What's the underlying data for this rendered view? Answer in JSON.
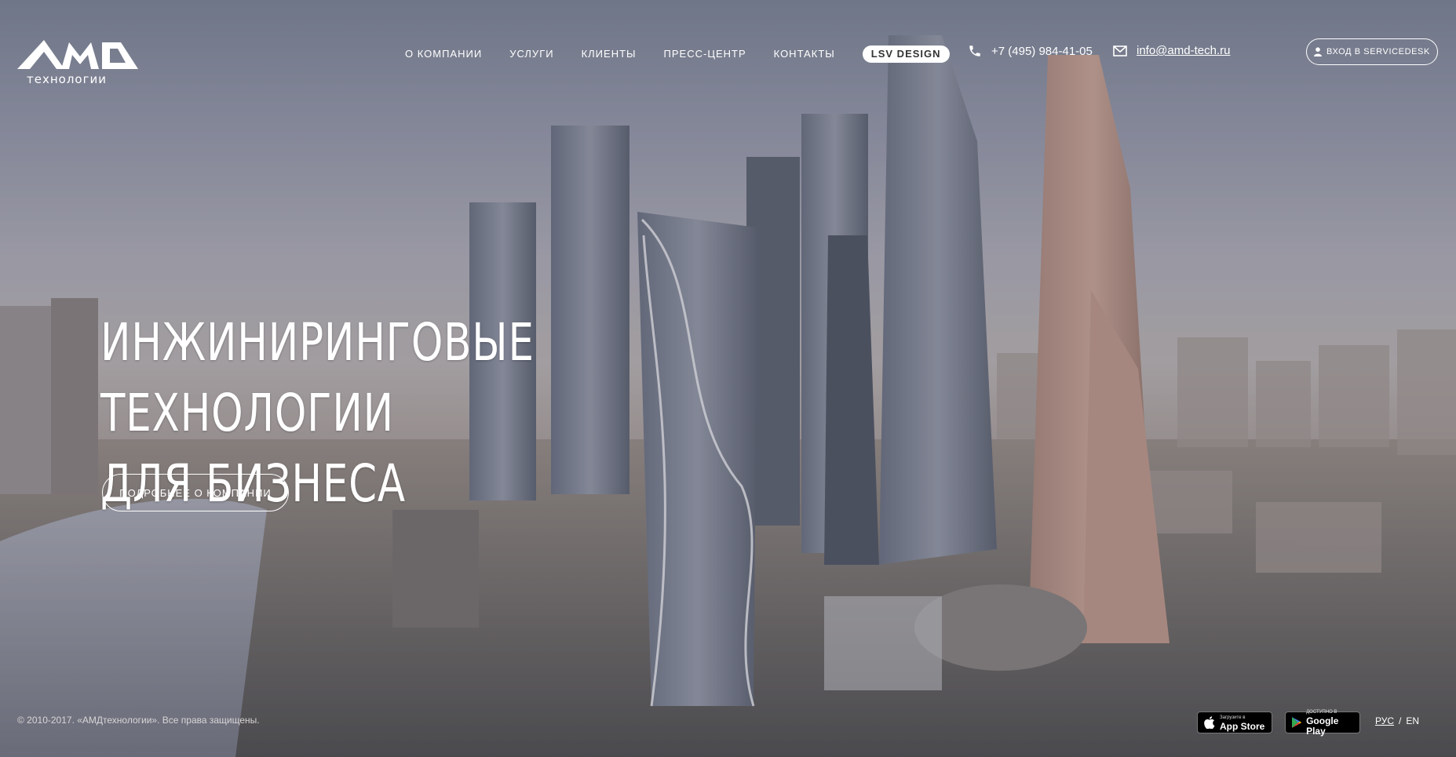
{
  "brand": {
    "logo_top": "AMD",
    "logo_bottom": "технологии"
  },
  "nav": {
    "items": [
      {
        "label": "О компании"
      },
      {
        "label": "Услуги"
      },
      {
        "label": "Клиенты"
      },
      {
        "label": "Пресс-центр"
      },
      {
        "label": "Контакты"
      },
      {
        "label": "LSV DESIGN"
      }
    ]
  },
  "contacts": {
    "phone": "+7 (495) 984-41-05",
    "email": "info@amd-tech.ru"
  },
  "servicedesk": {
    "label": "Вход в SERVICEDESK"
  },
  "hero": {
    "title_line1": "Инжиниринговые технологии",
    "title_line2": "для бизнеса",
    "cta": "Подробнее о компании"
  },
  "footer": {
    "copyright": "© 2010-2017. «АМДтехнологии». Все права защищены.",
    "appstore": {
      "small": "Загрузите в",
      "big": "App Store"
    },
    "googleplay": {
      "small": "ДОСТУПНО В",
      "big": "Google Play"
    },
    "lang": {
      "ru": "РУС",
      "separator": "/",
      "en": "EN"
    }
  },
  "icons": [
    "phone-icon",
    "mail-icon",
    "user-icon",
    "apple-icon",
    "google-play-icon"
  ],
  "colors": {
    "pill_bg": "#ffffff",
    "pill_text": "#333333",
    "overlay": "#6f7688"
  }
}
